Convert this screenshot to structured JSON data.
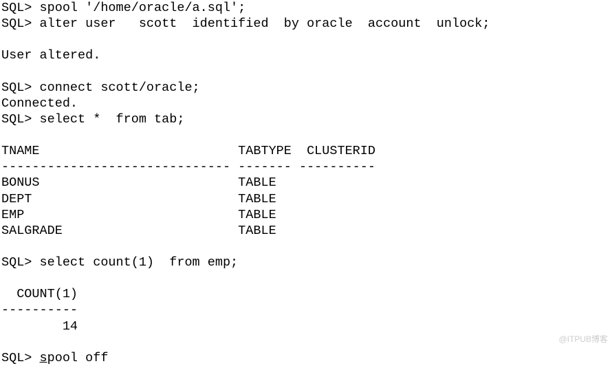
{
  "prompt": "SQL>",
  "lines": [
    {
      "prompt": true,
      "text": " spool '/home/oracle/a.sql';"
    },
    {
      "prompt": true,
      "text": " alter user   scott  identified  by oracle  account  unlock;"
    },
    {
      "prompt": false,
      "text": ""
    },
    {
      "prompt": false,
      "text": "User altered."
    },
    {
      "prompt": false,
      "text": ""
    },
    {
      "prompt": true,
      "text": " connect scott/oracle;"
    },
    {
      "prompt": false,
      "text": "Connected."
    },
    {
      "prompt": true,
      "text": " select *  from tab;"
    },
    {
      "prompt": false,
      "text": ""
    },
    {
      "prompt": false,
      "text": "TNAME                          TABTYPE  CLUSTERID"
    },
    {
      "prompt": false,
      "text": "------------------------------ ------- ----------"
    },
    {
      "prompt": false,
      "text": "BONUS                          TABLE"
    },
    {
      "prompt": false,
      "text": "DEPT                           TABLE"
    },
    {
      "prompt": false,
      "text": "EMP                            TABLE"
    },
    {
      "prompt": false,
      "text": "SALGRADE                       TABLE"
    },
    {
      "prompt": false,
      "text": ""
    },
    {
      "prompt": true,
      "text": " select count(1)  from emp;"
    },
    {
      "prompt": false,
      "text": ""
    },
    {
      "prompt": false,
      "text": "  COUNT(1)"
    },
    {
      "prompt": false,
      "text": "----------"
    },
    {
      "prompt": false,
      "text": "        14"
    },
    {
      "prompt": false,
      "text": ""
    }
  ],
  "last_line": {
    "prefix": " ",
    "underlined": "s",
    "suffix": "pool off"
  },
  "watermark": "@ITPUB博客"
}
